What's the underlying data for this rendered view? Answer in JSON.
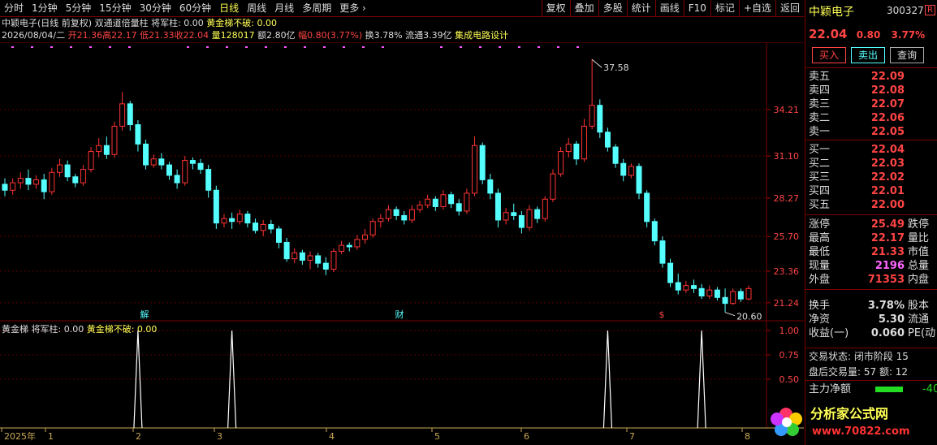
{
  "periods": [
    {
      "label": "分时",
      "active": false
    },
    {
      "label": "1分钟",
      "active": false
    },
    {
      "label": "5分钟",
      "active": false
    },
    {
      "label": "15分钟",
      "active": false
    },
    {
      "label": "30分钟",
      "active": false
    },
    {
      "label": "60分钟",
      "active": false
    },
    {
      "label": "日线",
      "active": true
    },
    {
      "label": "周线",
      "active": false
    },
    {
      "label": "月线",
      "active": false
    },
    {
      "label": "多周期",
      "active": false
    },
    {
      "label": "更多 ›",
      "active": false
    }
  ],
  "toolbar": [
    "复权",
    "叠加",
    "多股",
    "统计",
    "画线",
    "F10",
    "标记",
    "+自选",
    "返回"
  ],
  "info": {
    "stock_title": "中颖电子(日线 前复权)",
    "indicator": "双通道倍量柱",
    "jjz": "将军柱: 0.00",
    "hjt": "黄金梯不破: 0.00",
    "date": "2026/08/04/二",
    "open": "开21.36",
    "high": "高22.17",
    "low": "低21.33",
    "close": "收22.04",
    "volume": "量128017",
    "amount": "额2.80亿",
    "change": "幅0.80(3.77%)",
    "turnover": "换3.78%",
    "float": "流通3.39亿",
    "sector": "集成电路设计"
  },
  "sub_info": {
    "name": "黄金梯",
    "jjz": "将军柱: 0.00",
    "hjt": "黄金梯不破: 0.00"
  },
  "right": {
    "name": "中颖电子",
    "code": "300327",
    "badge": "R",
    "price": "22.04",
    "chg": "0.80",
    "pct": "3.77%",
    "buy_btn": "买入",
    "sell_btn": "卖出",
    "query_btn": "查询",
    "sells": [
      {
        "l": "卖五",
        "v": "22.09"
      },
      {
        "l": "卖四",
        "v": "22.08"
      },
      {
        "l": "卖三",
        "v": "22.07"
      },
      {
        "l": "卖二",
        "v": "22.06"
      },
      {
        "l": "卖一",
        "v": "22.05"
      }
    ],
    "buys": [
      {
        "l": "买一",
        "v": "22.04"
      },
      {
        "l": "买二",
        "v": "22.03"
      },
      {
        "l": "买三",
        "v": "22.02"
      },
      {
        "l": "买四",
        "v": "22.01"
      },
      {
        "l": "买五",
        "v": "22.00"
      }
    ],
    "stats": [
      {
        "l": "涨停",
        "v": "25.49",
        "l2": "跌停",
        "c": "#ff4444"
      },
      {
        "l": "最高",
        "v": "22.17",
        "l2": "量比",
        "c": "#ff4444"
      },
      {
        "l": "最低",
        "v": "21.33",
        "l2": "市值",
        "c": "#ff4444"
      },
      {
        "l": "现量",
        "v": "2196",
        "l2": "总量",
        "c": "#ff66ff"
      },
      {
        "l": "外盘",
        "v": "71353",
        "l2": "内盘",
        "c": "#ff4444"
      }
    ],
    "stats2": [
      {
        "l": "换手",
        "v": "3.78%",
        "l2": "股本",
        "c": "#ddd"
      },
      {
        "l": "净资",
        "v": "5.30",
        "l2": "流通",
        "c": "#ddd"
      },
      {
        "l": "收益(一)",
        "v": "0.060",
        "l2": "PE(动",
        "c": "#ddd"
      }
    ],
    "trade_state": "交易状态: 闭市阶段 15",
    "after_hours": "盘后交易量: 57  额: 12",
    "main_flow": "主力净额",
    "main_flow_val": "-40"
  },
  "logo": {
    "text": "分析家公式网",
    "url": "www.70822.com"
  },
  "chart_data": {
    "type": "candlestick",
    "y_ticks": [
      21.24,
      23.36,
      25.7,
      28.27,
      31.1,
      34.21
    ],
    "ylim": [
      20.2,
      38.3
    ],
    "x_labels": [
      "2025年",
      "1",
      "2",
      "3",
      "4",
      "5",
      "6",
      "7",
      "8"
    ],
    "annotations": [
      {
        "text": "37.58",
        "value": 37.58
      },
      {
        "text": "20.60",
        "value": 20.6
      }
    ],
    "markers": [
      "解",
      "财",
      "$"
    ],
    "sub_ticks": [
      "1.00",
      "0.75",
      "0.50"
    ],
    "sub_ylim": [
      0,
      1.1
    ],
    "sub_spikes": [
      17,
      29,
      77,
      89
    ],
    "candles": [
      [
        29.2,
        29.6,
        28.4,
        28.8
      ],
      [
        28.8,
        29.6,
        28.5,
        29.3
      ],
      [
        29.3,
        30.0,
        28.9,
        29.6
      ],
      [
        29.6,
        30.2,
        28.8,
        29.2
      ],
      [
        29.2,
        29.8,
        28.9,
        29.5
      ],
      [
        29.5,
        29.9,
        28.2,
        28.7
      ],
      [
        28.7,
        30.3,
        28.5,
        30.0
      ],
      [
        30.0,
        30.9,
        29.7,
        30.5
      ],
      [
        30.5,
        30.8,
        29.4,
        29.7
      ],
      [
        29.7,
        29.9,
        29.0,
        29.3
      ],
      [
        29.3,
        30.5,
        29.1,
        30.2
      ],
      [
        30.2,
        31.7,
        30.0,
        31.4
      ],
      [
        31.4,
        32.3,
        31.0,
        31.8
      ],
      [
        31.8,
        32.4,
        30.9,
        31.2
      ],
      [
        31.2,
        33.4,
        31.0,
        33.1
      ],
      [
        33.1,
        35.4,
        32.8,
        34.6
      ],
      [
        34.6,
        34.8,
        32.8,
        33.2
      ],
      [
        33.2,
        33.5,
        31.4,
        31.9
      ],
      [
        31.9,
        32.2,
        30.2,
        30.5
      ],
      [
        30.5,
        31.2,
        30.3,
        30.9
      ],
      [
        30.9,
        31.3,
        30.2,
        30.5
      ],
      [
        30.5,
        30.7,
        29.5,
        29.8
      ],
      [
        29.8,
        30.2,
        28.9,
        29.3
      ],
      [
        29.3,
        31.1,
        29.1,
        30.8
      ],
      [
        30.8,
        31.0,
        30.2,
        30.6
      ],
      [
        30.6,
        30.9,
        29.9,
        30.2
      ],
      [
        30.2,
        30.5,
        28.3,
        28.8
      ],
      [
        28.8,
        29.1,
        26.2,
        26.6
      ],
      [
        26.6,
        27.2,
        26.3,
        26.9
      ],
      [
        26.9,
        27.3,
        26.2,
        26.7
      ],
      [
        26.7,
        27.5,
        26.5,
        27.2
      ],
      [
        27.2,
        27.4,
        26.3,
        26.6
      ],
      [
        26.6,
        26.9,
        25.9,
        26.1
      ],
      [
        26.1,
        26.8,
        25.7,
        26.5
      ],
      [
        26.5,
        26.8,
        25.9,
        26.2
      ],
      [
        26.2,
        26.4,
        24.9,
        25.3
      ],
      [
        25.3,
        25.6,
        24.0,
        24.2
      ],
      [
        24.2,
        24.9,
        23.9,
        24.6
      ],
      [
        24.6,
        24.8,
        23.8,
        24.1
      ],
      [
        24.1,
        24.7,
        23.5,
        24.4
      ],
      [
        24.4,
        24.6,
        23.6,
        23.9
      ],
      [
        23.9,
        24.3,
        23.1,
        23.5
      ],
      [
        23.5,
        24.9,
        23.3,
        24.7
      ],
      [
        24.7,
        25.4,
        24.5,
        25.1
      ],
      [
        25.1,
        25.3,
        24.7,
        25.0
      ],
      [
        25.0,
        25.8,
        24.8,
        25.5
      ],
      [
        25.5,
        26.2,
        25.2,
        25.8
      ],
      [
        25.8,
        26.9,
        25.6,
        26.7
      ],
      [
        26.7,
        27.2,
        26.3,
        26.9
      ],
      [
        26.9,
        27.8,
        26.7,
        27.5
      ],
      [
        27.5,
        27.7,
        26.8,
        27.1
      ],
      [
        27.1,
        27.4,
        26.5,
        26.8
      ],
      [
        26.8,
        27.8,
        26.6,
        27.5
      ],
      [
        27.5,
        28.1,
        27.3,
        27.8
      ],
      [
        27.8,
        28.5,
        27.6,
        28.2
      ],
      [
        28.2,
        28.4,
        27.4,
        27.7
      ],
      [
        27.7,
        28.8,
        27.5,
        28.5
      ],
      [
        28.5,
        28.7,
        27.6,
        27.9
      ],
      [
        27.9,
        28.2,
        27.1,
        27.4
      ],
      [
        27.4,
        28.9,
        27.2,
        28.6
      ],
      [
        28.6,
        32.4,
        28.4,
        31.8
      ],
      [
        31.8,
        32.0,
        29.2,
        29.5
      ],
      [
        29.5,
        29.9,
        28.2,
        28.6
      ],
      [
        28.6,
        28.9,
        26.3,
        26.8
      ],
      [
        26.8,
        27.6,
        26.5,
        27.3
      ],
      [
        27.3,
        27.9,
        26.8,
        27.1
      ],
      [
        27.1,
        27.4,
        25.9,
        26.3
      ],
      [
        26.3,
        27.8,
        26.1,
        27.5
      ],
      [
        27.5,
        27.7,
        26.6,
        26.9
      ],
      [
        26.9,
        28.4,
        26.7,
        28.2
      ],
      [
        28.2,
        30.2,
        28.0,
        29.9
      ],
      [
        29.9,
        31.7,
        29.7,
        31.4
      ],
      [
        31.4,
        32.3,
        31.0,
        31.9
      ],
      [
        31.9,
        32.1,
        30.5,
        30.9
      ],
      [
        30.9,
        33.6,
        30.7,
        33.1
      ],
      [
        33.1,
        37.6,
        32.9,
        34.5
      ],
      [
        34.5,
        34.9,
        32.3,
        32.7
      ],
      [
        32.7,
        33.0,
        31.4,
        31.7
      ],
      [
        31.7,
        31.9,
        30.3,
        30.6
      ],
      [
        30.6,
        30.9,
        29.4,
        29.8
      ],
      [
        29.8,
        30.6,
        29.6,
        30.4
      ],
      [
        30.4,
        30.6,
        28.2,
        28.6
      ],
      [
        28.6,
        28.8,
        26.3,
        26.7
      ],
      [
        26.7,
        26.9,
        25.1,
        25.4
      ],
      [
        25.4,
        25.7,
        23.6,
        23.9
      ],
      [
        23.9,
        24.2,
        22.3,
        22.6
      ],
      [
        22.6,
        23.2,
        21.8,
        22.1
      ],
      [
        22.1,
        22.7,
        21.9,
        22.4
      ],
      [
        22.4,
        22.8,
        21.9,
        22.2
      ],
      [
        22.2,
        22.5,
        21.5,
        21.7
      ],
      [
        21.7,
        22.4,
        21.5,
        22.1
      ],
      [
        22.1,
        22.3,
        21.4,
        21.6
      ],
      [
        21.6,
        22.2,
        20.6,
        21.2
      ],
      [
        21.2,
        22.2,
        21.1,
        22.0
      ],
      [
        22.0,
        22.2,
        21.3,
        21.5
      ],
      [
        21.5,
        22.4,
        21.4,
        22.2
      ]
    ]
  }
}
